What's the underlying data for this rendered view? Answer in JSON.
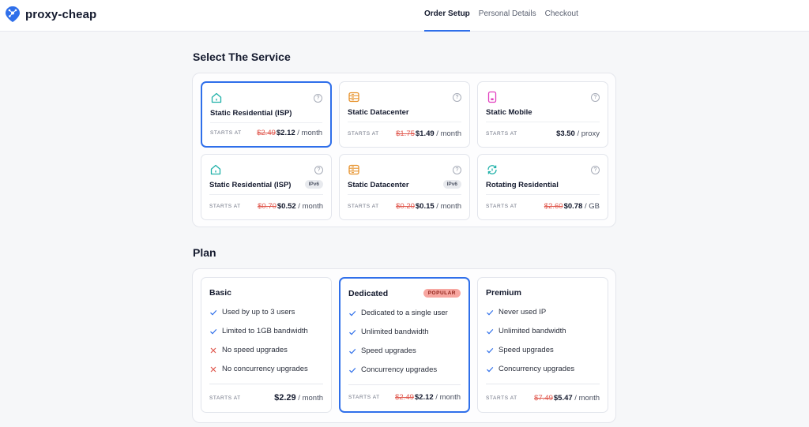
{
  "brand": {
    "name": "proxy-cheap",
    "color": "#2f6fea"
  },
  "nav": [
    {
      "label": "Order Setup",
      "active": true
    },
    {
      "label": "Personal Details",
      "active": false
    },
    {
      "label": "Checkout",
      "active": false
    }
  ],
  "service_section": {
    "title": "Select The Service",
    "cards": [
      {
        "name": "Static Residential (ISP)",
        "icon": "home-icon",
        "icon_color": "#20b1a9",
        "tag": "",
        "starts_label": "STARTS AT",
        "old_price": "$2.49",
        "price": "$2.12",
        "unit": " / month",
        "selected": true
      },
      {
        "name": "Static Datacenter",
        "icon": "server-icon",
        "icon_color": "#e7932d",
        "tag": "",
        "starts_label": "STARTS AT",
        "old_price": "$1.75",
        "price": "$1.49",
        "unit": " / month",
        "selected": false
      },
      {
        "name": "Static Mobile",
        "icon": "mobile-icon",
        "icon_color": "#e23fbf",
        "tag": "",
        "starts_label": "STARTS AT",
        "old_price": "",
        "price": "$3.50",
        "unit": " / proxy",
        "selected": false
      },
      {
        "name": "Static Residential (ISP)",
        "icon": "home-icon",
        "icon_color": "#20b1a9",
        "tag": "IPv6",
        "starts_label": "STARTS AT",
        "old_price": "$0.70",
        "price": "$0.52",
        "unit": " / month",
        "selected": false
      },
      {
        "name": "Static Datacenter",
        "icon": "server-icon",
        "icon_color": "#e7932d",
        "tag": "IPv6",
        "starts_label": "STARTS AT",
        "old_price": "$0.20",
        "price": "$0.15",
        "unit": " / month",
        "selected": false
      },
      {
        "name": "Rotating Residential",
        "icon": "rotate-icon",
        "icon_color": "#20b1a9",
        "tag": "",
        "starts_label": "STARTS AT",
        "old_price": "$2.60",
        "price": "$0.78",
        "unit": " / GB",
        "selected": false
      }
    ]
  },
  "plan_section": {
    "title": "Plan",
    "plans": [
      {
        "name": "Basic",
        "badge": "",
        "selected": false,
        "features": [
          {
            "text": "Used by up to 3 users",
            "included": true
          },
          {
            "text": "Limited to 1GB bandwidth",
            "included": true
          },
          {
            "text": "No speed upgrades",
            "included": false
          },
          {
            "text": "No concurrency upgrades",
            "included": false
          }
        ],
        "starts_label": "STARTS AT",
        "old_price": "",
        "price": "$2.29",
        "unit": " / month"
      },
      {
        "name": "Dedicated",
        "badge": "POPULAR",
        "selected": true,
        "features": [
          {
            "text": "Dedicated to a single user",
            "included": true
          },
          {
            "text": "Unlimited bandwidth",
            "included": true
          },
          {
            "text": "Speed upgrades",
            "included": true
          },
          {
            "text": "Concurrency upgrades",
            "included": true
          }
        ],
        "starts_label": "STARTS AT",
        "old_price": "$2.49",
        "price": "$2.12",
        "unit": " / month"
      },
      {
        "name": "Premium",
        "badge": "",
        "selected": false,
        "features": [
          {
            "text": "Never used IP",
            "included": true
          },
          {
            "text": "Unlimited bandwidth",
            "included": true
          },
          {
            "text": "Speed upgrades",
            "included": true
          },
          {
            "text": "Concurrency upgrades",
            "included": true
          }
        ],
        "starts_label": "STARTS AT",
        "old_price": "$7.49",
        "price": "$5.47",
        "unit": " / month"
      }
    ]
  },
  "colors": {
    "accent": "#2f6fea",
    "strike": "#e0594f",
    "check": "#2f6fea",
    "cross": "#e0594f"
  }
}
